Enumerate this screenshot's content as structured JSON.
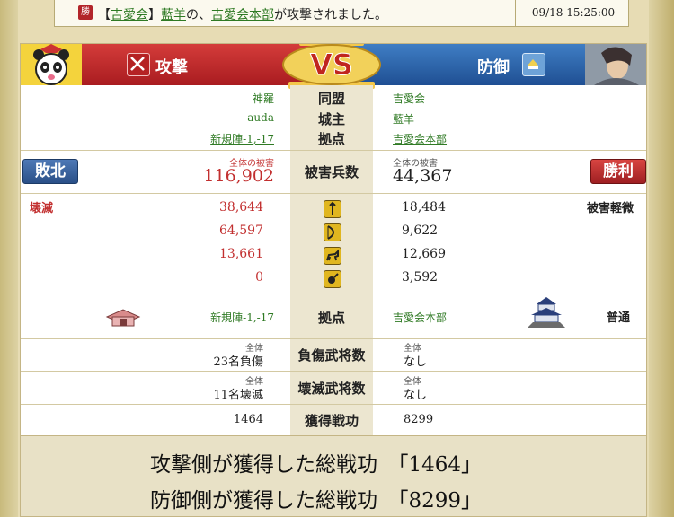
{
  "notice": {
    "win_icon": "勝",
    "prefix": "【",
    "alliance": "吉愛会",
    "mid1": "】",
    "player": "藍羊",
    "mid2": "の、",
    "base": "吉愛会本部",
    "suffix": "が攻撃されました。",
    "timestamp": "09/18 15:25:00"
  },
  "header": {
    "attack_label": "攻撃",
    "defense_label": "防御",
    "vs_label": "VS"
  },
  "info": {
    "alliance_label": "同盟",
    "owner_label": "城主",
    "base_label": "拠点",
    "attacker_alliance": "神羅",
    "attacker_owner": "auda",
    "attacker_base": "新規陣-1,-17",
    "defender_alliance": "吉愛会",
    "defender_owner": "藍羊",
    "defender_base": "吉愛会本部"
  },
  "damage": {
    "result_attacker": "敗北",
    "result_defender": "勝利",
    "label": "被害兵数",
    "total_caption_attacker": "全体の被害",
    "total_caption_defender": "全体の被害",
    "attacker_total": "116,902",
    "defender_total": "44,367"
  },
  "units": {
    "attacker_status": "壊滅",
    "defender_status": "被害軽微",
    "rows": [
      {
        "icon": "spear-unit-icon",
        "attacker": "38,644",
        "defender": "18,484"
      },
      {
        "icon": "bow-unit-icon",
        "attacker": "64,597",
        "defender": "9,622"
      },
      {
        "icon": "cavalry-unit-icon",
        "attacker": "13,661",
        "defender": "12,669"
      },
      {
        "icon": "siege-unit-icon",
        "attacker": "0",
        "defender": "3,592"
      }
    ]
  },
  "base_row": {
    "label": "拠点",
    "attacker_base": "新規陣-1,-17",
    "defender_base": "吉愛会本部",
    "defender_state": "普通"
  },
  "injured": {
    "label": "負傷武将数",
    "caption_attacker": "全体",
    "caption_defender": "全体",
    "attacker": "23名負傷",
    "defender": "なし"
  },
  "destroyed": {
    "label": "壊滅武将数",
    "caption_attacker": "全体",
    "caption_defender": "全体",
    "attacker": "11名壊滅",
    "defender": "なし"
  },
  "merit": {
    "label": "獲得戦功",
    "attacker": "1464",
    "defender": "8299"
  },
  "summary": {
    "line1": "攻撃側が獲得した総戦功　「1464」",
    "line2": "防御側が獲得した総戦功　「8299」"
  }
}
